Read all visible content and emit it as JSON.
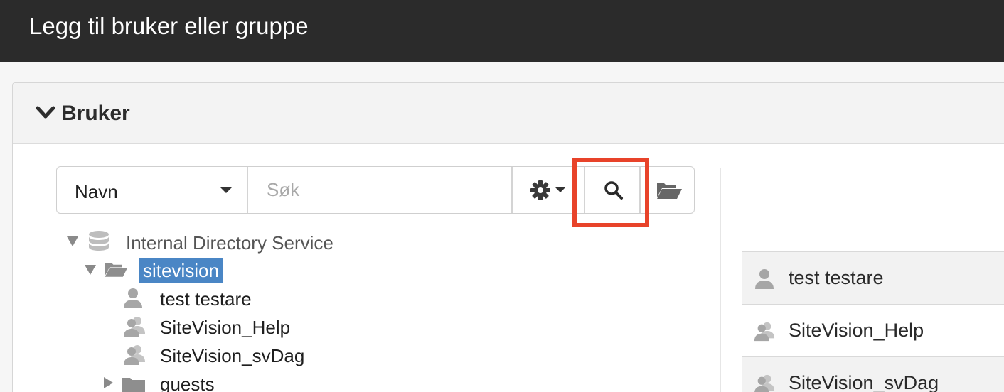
{
  "dialog": {
    "title": "Legg til bruker eller gruppe"
  },
  "section": {
    "label": "Bruker"
  },
  "toolbar": {
    "field_select": "Navn",
    "search_placeholder": "Søk"
  },
  "tree": {
    "root": "Internal Directory Service",
    "folder": "sitevision",
    "items": [
      "test testare",
      "SiteVision_Help",
      "SiteVision_svDag"
    ],
    "subfolder": "guests"
  },
  "selected_list": [
    "test testare",
    "SiteVision_Help",
    "SiteVision_svDag"
  ],
  "colors": {
    "highlight": "#e8432a",
    "selected_node": "#4a86c5",
    "title_bar": "#2b2b2b"
  }
}
